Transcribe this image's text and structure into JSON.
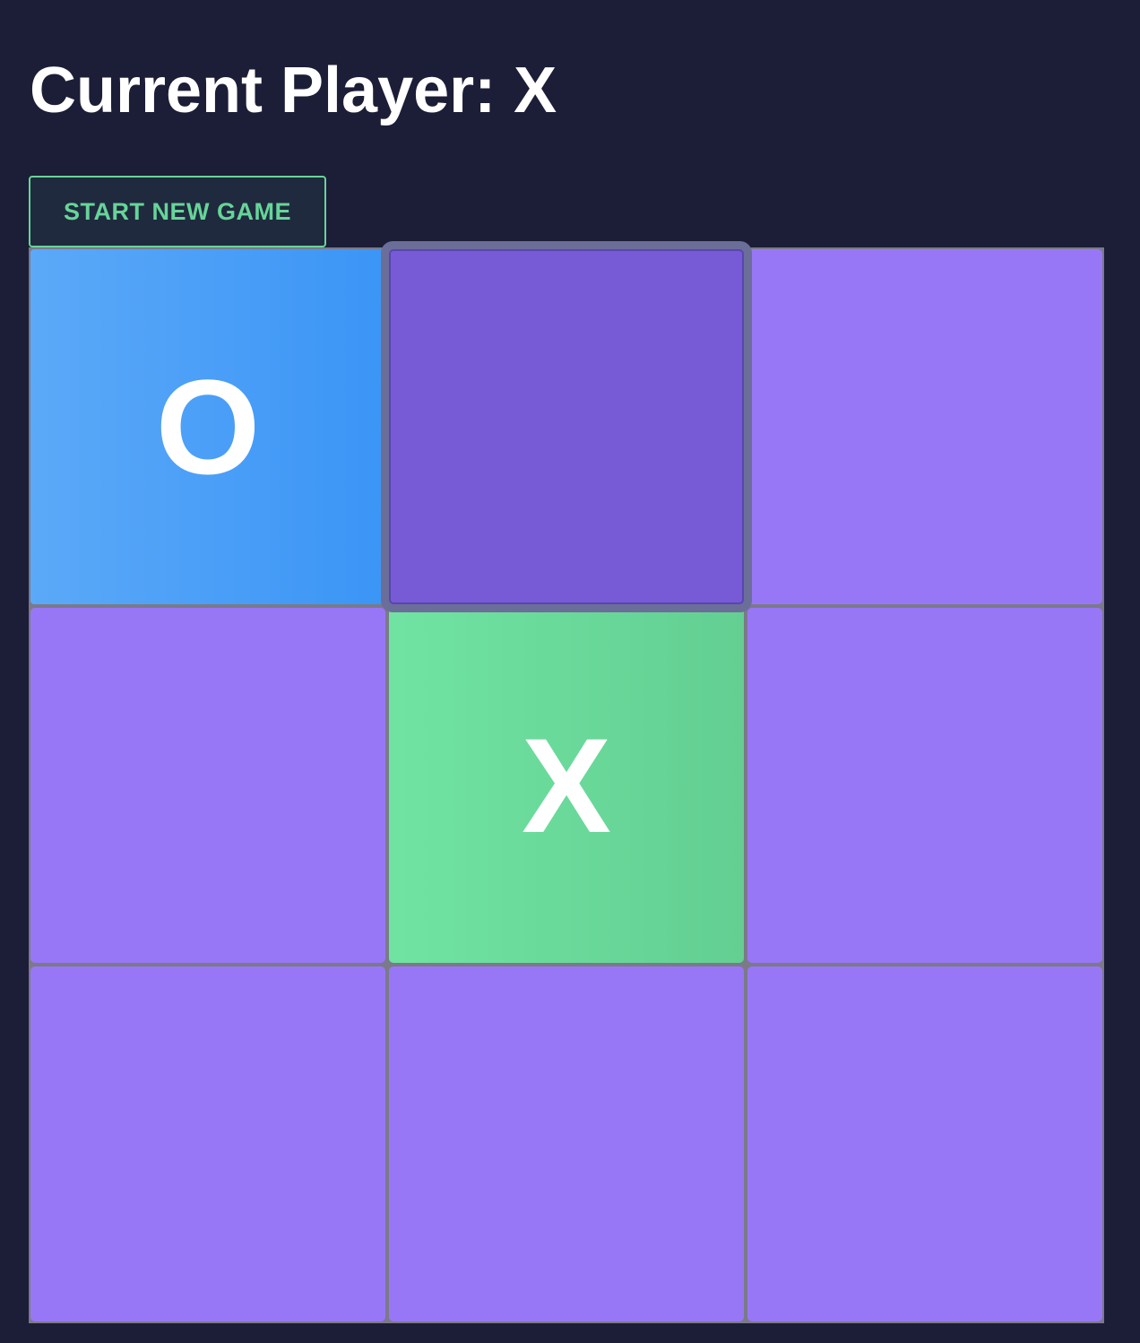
{
  "status": {
    "text": "Current Player: X"
  },
  "controls": {
    "reset_label": "START NEW GAME"
  },
  "board": {
    "cells": [
      {
        "mark": "O",
        "state": "filled"
      },
      {
        "mark": "",
        "state": "hovered"
      },
      {
        "mark": "",
        "state": "empty"
      },
      {
        "mark": "",
        "state": "empty"
      },
      {
        "mark": "X",
        "state": "filled"
      },
      {
        "mark": "",
        "state": "empty"
      },
      {
        "mark": "",
        "state": "empty"
      },
      {
        "mark": "",
        "state": "empty"
      },
      {
        "mark": "",
        "state": "empty"
      }
    ]
  },
  "colors": {
    "background": "#1c1d37",
    "accent": "#67d499",
    "empty_cell": "#9877f6",
    "hovered_cell": "#775bd6",
    "o_cell": "#3b95f6",
    "x_cell": "#63cf92"
  }
}
